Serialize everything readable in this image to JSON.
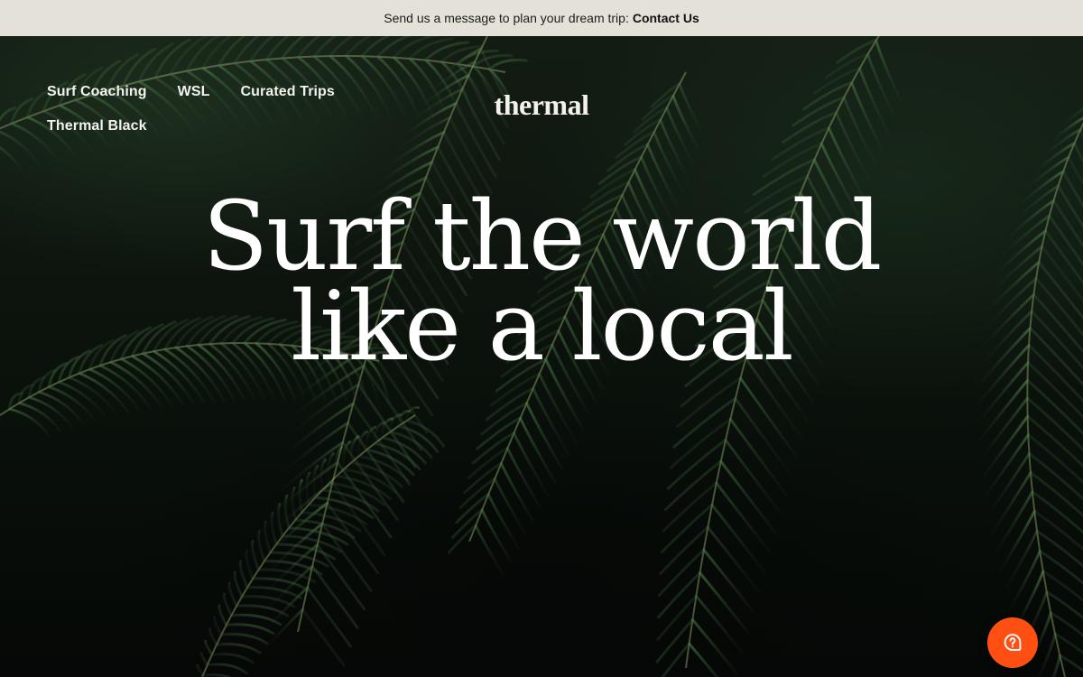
{
  "announcement": {
    "text": "Send us a message to plan your dream trip:",
    "link_label": "Contact Us"
  },
  "nav": {
    "items": [
      {
        "label": "Surf Coaching"
      },
      {
        "label": "WSL"
      },
      {
        "label": "Curated Trips"
      },
      {
        "label": "Thermal Black"
      }
    ]
  },
  "logo": {
    "text": "thermal"
  },
  "hero": {
    "headline_line1": "Surf the world",
    "headline_line2": "like a local"
  },
  "help_button": {
    "icon": "help-chat-icon",
    "color": "#ff4f12"
  },
  "colors": {
    "announcement_bg": "#e3e1d8",
    "accent": "#ff4f12",
    "hero_text": "#ffffff"
  }
}
